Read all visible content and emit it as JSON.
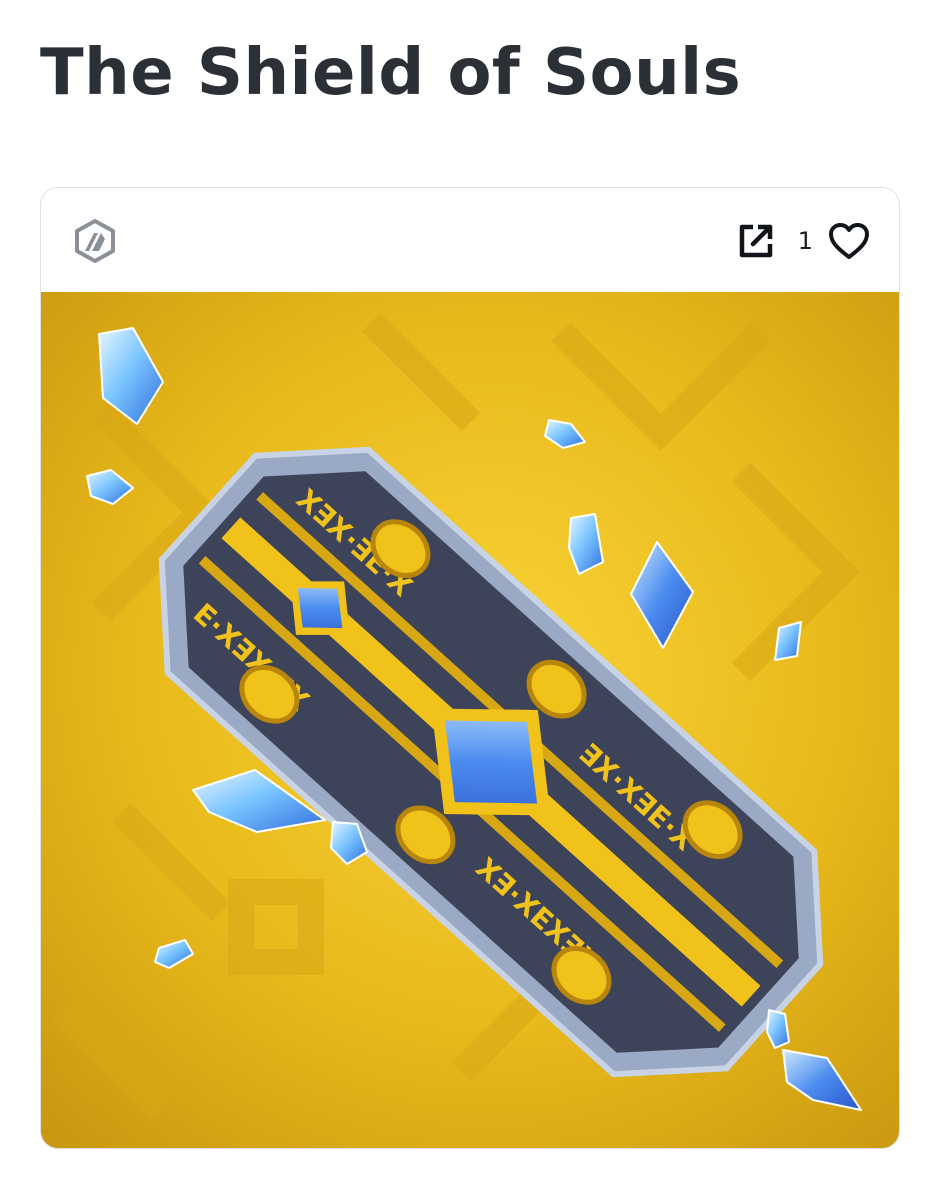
{
  "page": {
    "title": "The Shield of Souls"
  },
  "card": {
    "chain_icon": "arbitrum-chain-icon",
    "share_icon": "external-link-icon",
    "like_icon": "heart-outline-icon",
    "like_count": "1"
  },
  "artwork": {
    "background_color": "#e6b81a",
    "shield_color": "#3d4358",
    "trim_color": "#9aa9c4",
    "gold_color": "#f1c21a",
    "crystal_color": "#5fb3f5"
  }
}
